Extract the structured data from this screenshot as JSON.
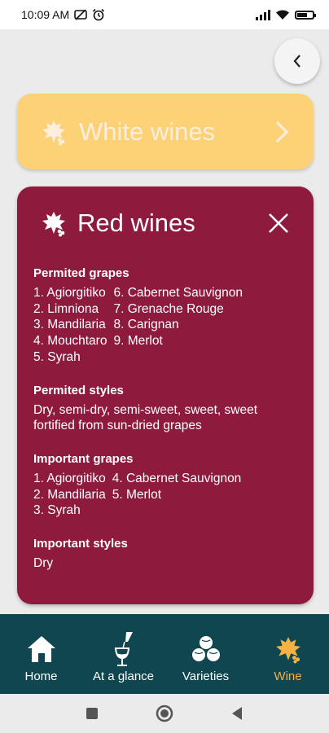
{
  "status": {
    "time": "10:09 AM",
    "battery": "80"
  },
  "white_card": {
    "title": "White wines"
  },
  "red_card": {
    "title": "Red wines",
    "sections": {
      "permitted_grapes": {
        "heading": "Permited grapes",
        "col1": [
          "1. Agiorgitiko",
          "2. Limniona",
          "3. Mandilaria",
          "4. Mouchtaro",
          "5. Syrah"
        ],
        "col2": [
          "6. Cabernet Sauvignon",
          "7. Grenache Rouge",
          "8. Carignan",
          "9. Merlot"
        ]
      },
      "permitted_styles": {
        "heading": "Permited styles",
        "text": "Dry, semi-dry, semi-sweet, sweet, sweet fortified from sun-dried grapes"
      },
      "important_grapes": {
        "heading": "Important grapes",
        "col1": [
          "1. Agiorgitiko",
          "2. Mandilaria",
          "3. Syrah"
        ],
        "col2": [
          "4. Cabernet Sauvignon",
          "5. Merlot"
        ]
      },
      "important_styles": {
        "heading": "Important styles",
        "text": "Dry"
      }
    }
  },
  "nav": [
    {
      "label": "Home",
      "icon": "home-icon"
    },
    {
      "label": "At a glance",
      "icon": "wine-pour-icon"
    },
    {
      "label": "Varieties",
      "icon": "grapes-icon"
    },
    {
      "label": "Wine",
      "icon": "grape-leaf-icon"
    }
  ],
  "colors": {
    "white_card": "#fdd175",
    "red_card": "#8e1a3e",
    "nav_bg": "#0f4650",
    "nav_active": "#f4b144"
  }
}
